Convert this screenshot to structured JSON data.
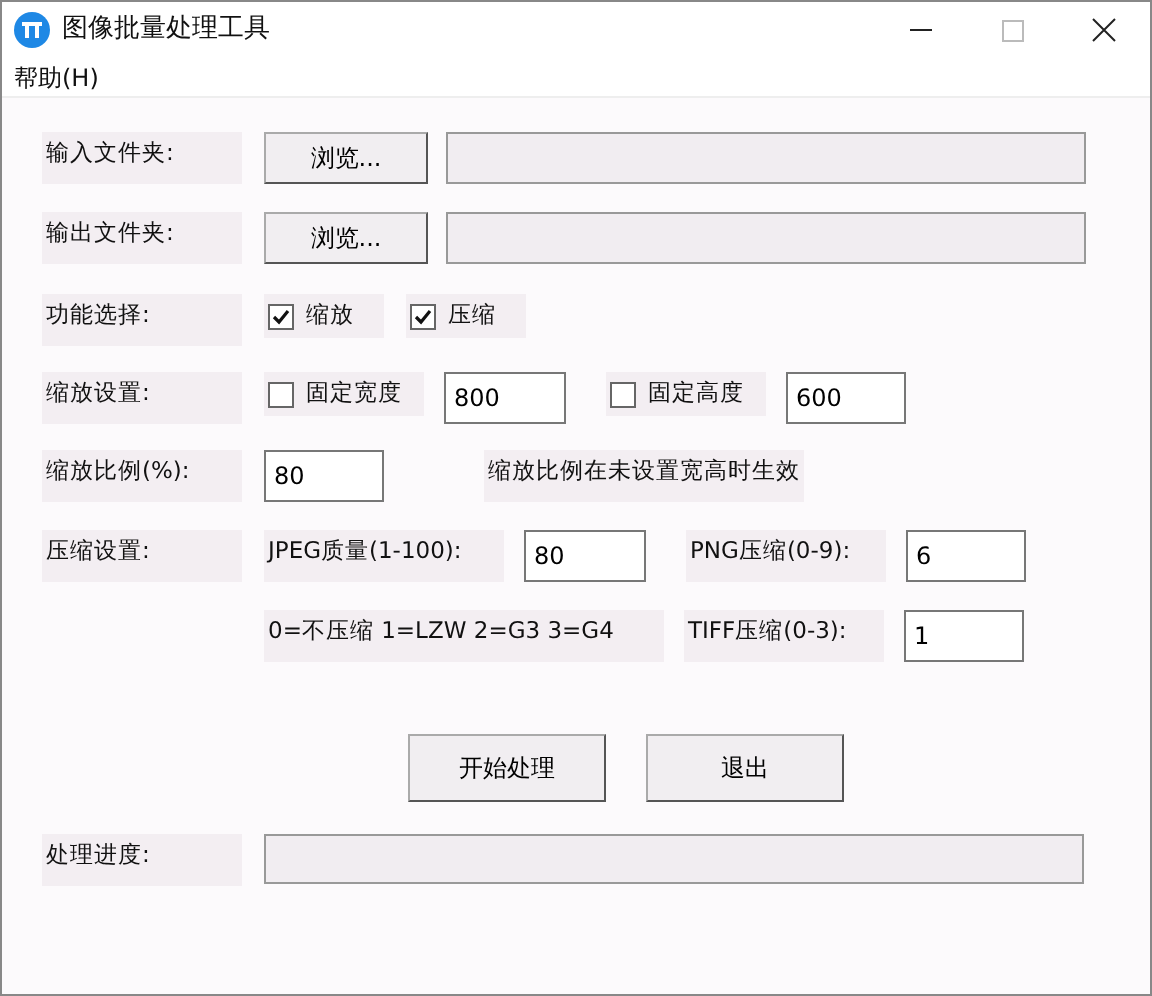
{
  "window": {
    "title": "图像批量处理工具"
  },
  "menu": [
    {
      "label": "帮助(H)"
    }
  ],
  "input_folder": {
    "label": "输入文件夹:",
    "button": "浏览..."
  },
  "output_folder": {
    "label": "输出文件夹:",
    "button": "浏览..."
  },
  "functions": {
    "label": "功能选择:",
    "options": [
      {
        "label": "缩放",
        "checked": true
      },
      {
        "label": "压缩",
        "checked": true
      }
    ]
  },
  "resize": {
    "label": "缩放设置:",
    "width": {
      "label": "固定宽度",
      "checked": false,
      "value": "800"
    },
    "height": {
      "label": "固定高度",
      "checked": false,
      "value": "600"
    }
  },
  "scale": {
    "label": "缩放比例(%):",
    "value": "80",
    "note": "缩放比例在未设置宽高时生效"
  },
  "compression": {
    "label": "压缩设置:",
    "jpeg": {
      "label": "JPEG质量(1-100):",
      "value": "80"
    },
    "png": {
      "label": "PNG压缩(0-9):",
      "value": "6"
    },
    "tiff_note": "0=不压缩 1=LZW 2=G3 3=G4",
    "tiff": {
      "label": "TIFF压缩(0-3):",
      "value": "1"
    }
  },
  "actions": [
    "开始处理",
    "退出"
  ],
  "progress": {
    "label": "处理进度:",
    "level": 0
  }
}
